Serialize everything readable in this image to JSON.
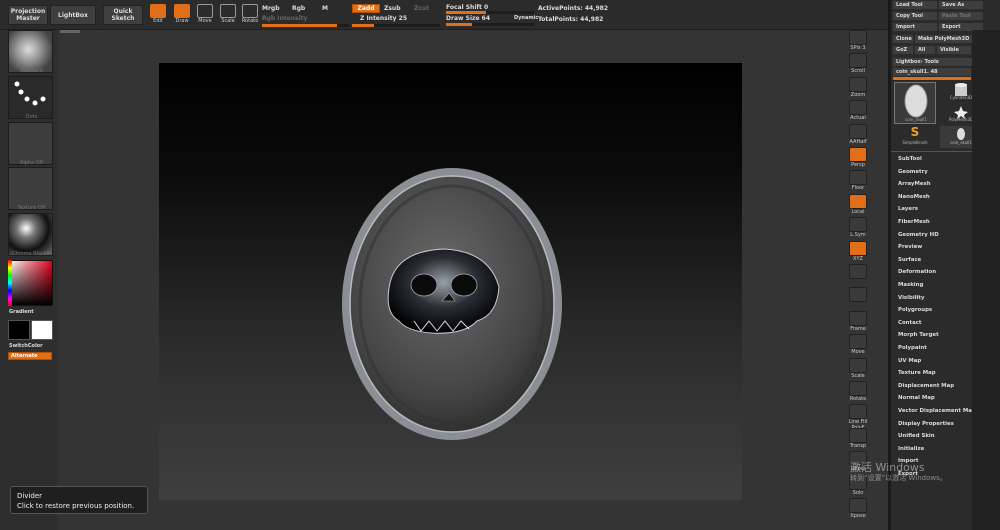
{
  "toolbar": {
    "projection_master": "Projection Master",
    "lightbox": "LightBox",
    "quick_sketch": "Quick Sketch",
    "edit": "Edit",
    "draw": "Draw",
    "move": "Move",
    "scale": "Scale",
    "rotate": "Rotate",
    "mrgb": "Mrgb",
    "rgb": "Rgb",
    "m": "M",
    "rgb_intensity": "Rgb Intensity",
    "zadd": "Zadd",
    "zsub": "Zsub",
    "zcut": "Zcut",
    "z_intensity": "Z Intensity 25",
    "focal_shift": "Focal Shift 0",
    "draw_size": "Draw Size 64",
    "dynamic": "Dynamic",
    "active_points": "ActivePoints: 44,982",
    "total_points": "TotalPoints: 44,982",
    "z_intensity_value": 25,
    "draw_size_value": 64
  },
  "left": {
    "brush_label": "Standard",
    "stroke_label": "Dots",
    "alpha_label": "Alpha Off",
    "texture_label": "Texture Off",
    "material_label": "Chrome BlackM",
    "gradient": "Gradient",
    "switch_color": "SwitchColor",
    "alternate": "Alternate"
  },
  "right_tools": [
    "SPix 3",
    "Scroll",
    "Zoom",
    "Actual",
    "AAHalf",
    "Persp",
    "Floor",
    "Local",
    "L.Sym",
    "XYZ",
    "",
    "",
    "Frame",
    "Move",
    "Scale",
    "Rotate",
    "Line Fill PolyF",
    "Transp",
    "Ghost",
    "Solo",
    "Xpose"
  ],
  "panel": {
    "load_tool": "Load Tool",
    "save_as": "Save As",
    "copy_tool": "Copy Tool",
    "paste_tool": "Paste Tool",
    "import": "Import",
    "export": "Export",
    "clone": "Clone",
    "make_polymesh": "Make PolyMesh3D",
    "goz": "GoZ",
    "all": "All",
    "visible": "Visible",
    "r": "R",
    "lightbox_tools": "Lightbox› Tools",
    "tool_name": "coin_skull1. 48",
    "thumbs": [
      "coin_skull1",
      "Cylinder3D",
      "SimpleBrush",
      "PolyMesh3D",
      "coin_skull1"
    ],
    "menu": [
      "SubTool",
      "Geometry",
      "ArrayMesh",
      "NanoMesh",
      "Layers",
      "FiberMesh",
      "Geometry HD",
      "Preview",
      "Surface",
      "Deformation",
      "Masking",
      "Visibility",
      "Polygroups",
      "Contact",
      "Morph Target",
      "Polypaint",
      "UV Map",
      "Texture Map",
      "Displacement Map",
      "Normal Map",
      "Vector Displacement Map",
      "Display Properties",
      "Unified Skin",
      "Initialize",
      "Import",
      "Export"
    ]
  },
  "tooltip": {
    "title": "Divider",
    "text": "Click to restore previous position."
  },
  "watermark": {
    "line1": "激活 Windows",
    "line2": "转到“设置”以激活 Windows。"
  }
}
